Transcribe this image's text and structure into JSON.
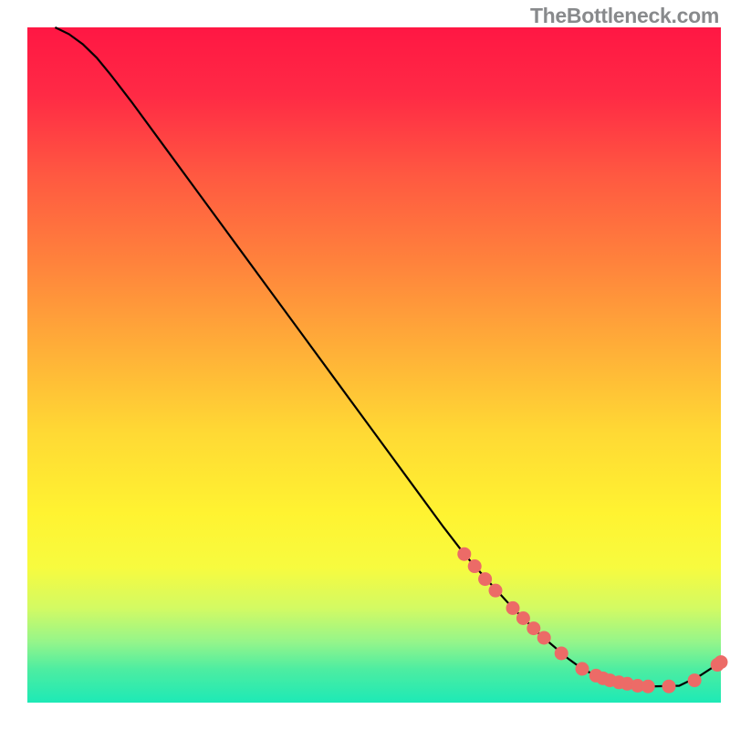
{
  "watermark": "TheBottleneck.com",
  "chart_data": {
    "type": "line",
    "title": "",
    "xlabel": "",
    "ylabel": "",
    "xlim": [
      0,
      100
    ],
    "ylim": [
      0,
      100
    ],
    "series": [
      {
        "name": "curve",
        "x": [
          4,
          6,
          8,
          10,
          12,
          15,
          20,
          25,
          30,
          35,
          40,
          45,
          50,
          55,
          60,
          63,
          66,
          70,
          74,
          78,
          80,
          82,
          84,
          86,
          88,
          90,
          94,
          97,
          100
        ],
        "y": [
          100,
          99,
          97.5,
          95.5,
          93,
          89,
          82,
          75,
          68,
          61,
          54,
          47,
          40,
          33,
          26,
          22,
          18.5,
          14,
          10,
          6.5,
          5,
          4,
          3.3,
          2.8,
          2.5,
          2.4,
          2.5,
          4,
          6
        ]
      }
    ],
    "markers": {
      "color": "#ec6b67",
      "points": [
        {
          "x": 63,
          "y": 22
        },
        {
          "x": 64.5,
          "y": 20.2
        },
        {
          "x": 66,
          "y": 18.3
        },
        {
          "x": 67.5,
          "y": 16.6
        },
        {
          "x": 70,
          "y": 14
        },
        {
          "x": 71.5,
          "y": 12.5
        },
        {
          "x": 73,
          "y": 11
        },
        {
          "x": 74.5,
          "y": 9.6
        },
        {
          "x": 77,
          "y": 7.3
        },
        {
          "x": 80,
          "y": 5
        },
        {
          "x": 82,
          "y": 4
        },
        {
          "x": 83,
          "y": 3.6
        },
        {
          "x": 84,
          "y": 3.3
        },
        {
          "x": 85.3,
          "y": 3.0
        },
        {
          "x": 86.5,
          "y": 2.8
        },
        {
          "x": 88,
          "y": 2.5
        },
        {
          "x": 89.5,
          "y": 2.4
        },
        {
          "x": 92.5,
          "y": 2.4
        },
        {
          "x": 96.2,
          "y": 3.3
        },
        {
          "x": 99.5,
          "y": 5.6
        },
        {
          "x": 100,
          "y": 6
        }
      ]
    },
    "gradient_stops": [
      {
        "offset": 0,
        "color": "#ff1744"
      },
      {
        "offset": 0.1,
        "color": "#ff2a45"
      },
      {
        "offset": 0.22,
        "color": "#ff5941"
      },
      {
        "offset": 0.35,
        "color": "#ff833c"
      },
      {
        "offset": 0.48,
        "color": "#ffb038"
      },
      {
        "offset": 0.6,
        "color": "#ffd934"
      },
      {
        "offset": 0.72,
        "color": "#fff331"
      },
      {
        "offset": 0.8,
        "color": "#f7fb3f"
      },
      {
        "offset": 0.86,
        "color": "#d3fa63"
      },
      {
        "offset": 0.91,
        "color": "#95f58a"
      },
      {
        "offset": 0.95,
        "color": "#4eeda1"
      },
      {
        "offset": 1.0,
        "color": "#1de9b6"
      }
    ]
  }
}
